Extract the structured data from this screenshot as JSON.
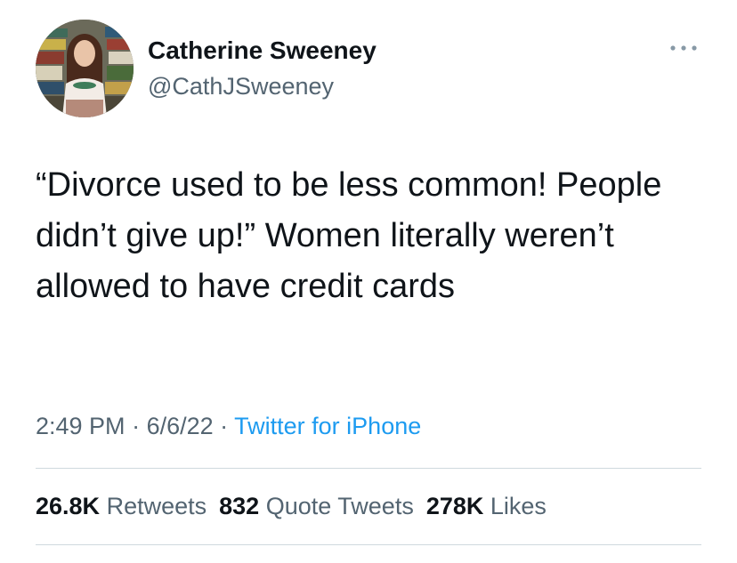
{
  "tweet": {
    "author": {
      "display_name": "Catherine Sweeney",
      "handle": "@CathJSweeney",
      "avatar_icon": "profile-photo"
    },
    "more_icon": "more-horizontal-icon",
    "text": "“Divorce used to be less common! People didn’t give up!” Women literally weren’t allowed to have credit cards",
    "meta": {
      "time": "2:49 PM",
      "separator": " · ",
      "date": "6/6/22",
      "source": "Twitter for iPhone"
    },
    "stats": {
      "retweets_count": "26.8K",
      "retweets_label": "Retweets",
      "quotes_count": "832",
      "quotes_label": "Quote Tweets",
      "likes_count": "278K",
      "likes_label": "Likes"
    }
  },
  "colors": {
    "text_primary": "#0f1419",
    "text_secondary": "#536471",
    "link": "#1d9bf0",
    "divider": "#cfd9de"
  }
}
